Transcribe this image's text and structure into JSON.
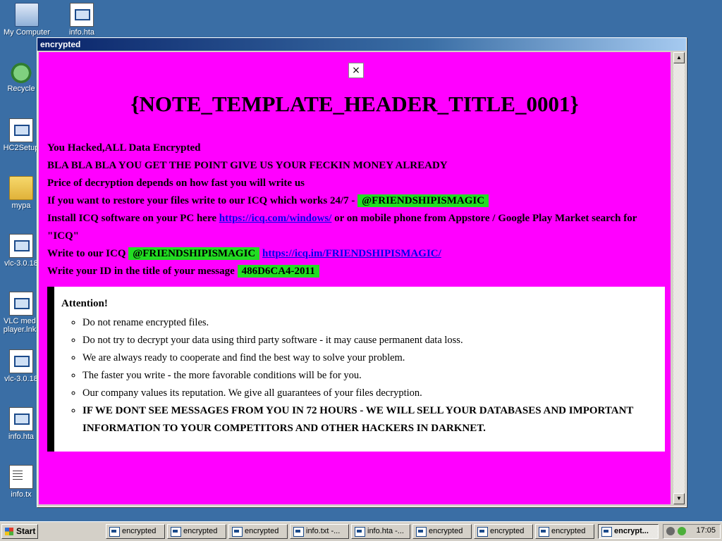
{
  "desktop": {
    "icons": [
      {
        "label": "My Computer"
      },
      {
        "label": "info.hta"
      },
      {
        "label": "Recycle"
      },
      {
        "label": "HC2Setup"
      },
      {
        "label": "mypa"
      },
      {
        "label": "vlc-3.0.18"
      },
      {
        "label": "VLC med player.lnk"
      },
      {
        "label": "vlc-3.0.18"
      },
      {
        "label": "info.hta"
      },
      {
        "label": "info.tx"
      }
    ]
  },
  "window": {
    "title": "encrypted",
    "close_glyph": "×",
    "note_title": "{NOTE_TEMPLATE_HEADER_TITLE_0001}",
    "line1": "You Hacked,ALL Data Encrypted",
    "line2": "BLA BLA BLA YOU GET THE POINT GIVE US YOUR FECKIN MONEY ALREADY",
    "line3": "Price of decryption depends on how fast you will write us",
    "line4_text": "If you want to restore your files write to our ICQ which works 24/7 - ",
    "icq_handle": "@FRIENDSHIPISMAGIC",
    "line5_text_a": "Install ICQ software on your PC here ",
    "icq_windows_link": "https://icq.com/windows/",
    "line5_text_b": " or on mobile phone from Appstore / Google Play Market search for \"ICQ\"",
    "line6_text": "Write to our ICQ ",
    "icq_direct_link": "https://icq.im/FRIENDSHIPISMAGIC/",
    "line7_text": "Write your ID in the title of your message ",
    "victim_id": "486D6CA4-2011",
    "attention": {
      "title": "Attention!",
      "items": [
        "Do not rename encrypted files.",
        "Do not try to decrypt your data using third party software - it may cause permanent data loss.",
        "We are always ready to cooperate and find the best way to solve your problem.",
        "The faster you write - the more favorable conditions will be for you.",
        "Our company values its reputation. We give all guarantees of your files decryption.",
        "IF WE DONT SEE MESSAGES FROM YOU IN 72 HOURS - WE WILL SELL YOUR DATABASES AND IMPORTANT INFORMATION TO YOUR COMPETITORS AND OTHER HACKERS IN DARKNET."
      ]
    },
    "colors": {
      "background": "#ff00ff",
      "highlight": "#22dd22"
    }
  },
  "taskbar": {
    "start_label": "Start",
    "tasks": [
      {
        "label": "encrypted"
      },
      {
        "label": "encrypted"
      },
      {
        "label": "encrypted"
      },
      {
        "label": "info.txt -..."
      },
      {
        "label": "info.hta -..."
      },
      {
        "label": "encrypted"
      },
      {
        "label": "encrypted"
      },
      {
        "label": "encrypted"
      },
      {
        "label": "encrypt..."
      }
    ],
    "clock": "17:05"
  }
}
